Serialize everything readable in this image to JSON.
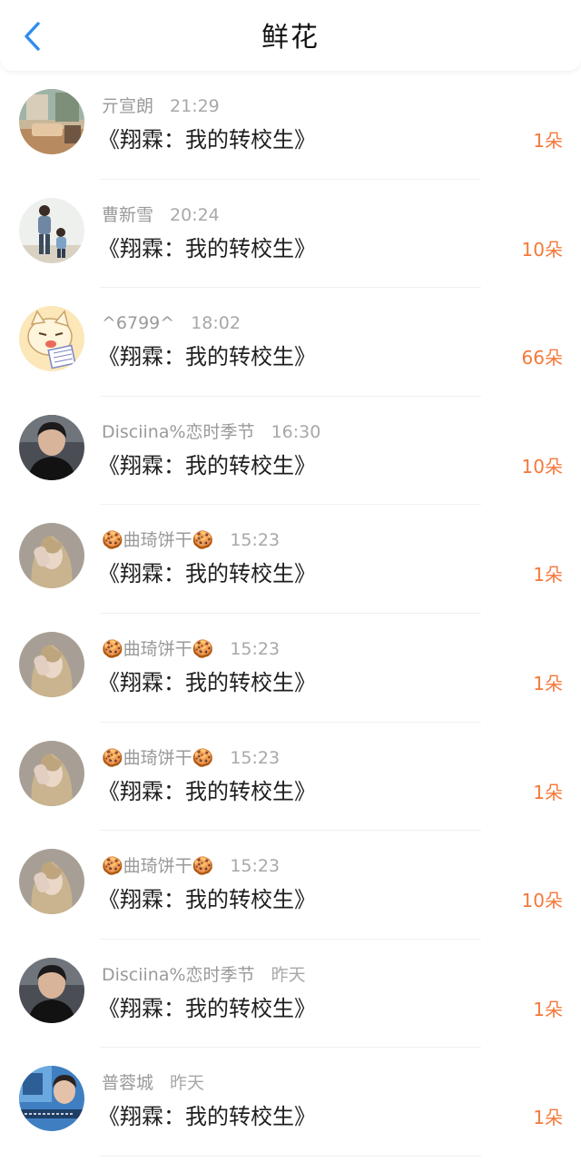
{
  "nav": {
    "title": "鲜花",
    "back_icon": "chevron-left-icon",
    "accent": "#2f8cf0"
  },
  "colors": {
    "count": "#f5783a"
  },
  "items": [
    {
      "name": "亓宣朗",
      "time": "21:29",
      "book": "《翔霖：我的转校生》",
      "count": "1朵",
      "avatar": "room-photo"
    },
    {
      "name": "曹新雪",
      "time": "20:24",
      "book": "《翔霖：我的转校生》",
      "count": "10朵",
      "avatar": "father-child-photo"
    },
    {
      "name": "^6799^",
      "time": "18:02",
      "book": "《翔霖：我的转校生》",
      "count": "66朵",
      "avatar": "cartoon-cat"
    },
    {
      "name": "Disciina%恋时季节",
      "time": "16:30",
      "book": "《翔霖：我的转校生》",
      "count": "10朵",
      "avatar": "boy-photo"
    },
    {
      "name": "🍪曲琦饼干🍪",
      "time": "15:23",
      "book": "《翔霖：我的转校生》",
      "count": "1朵",
      "avatar": "girl-photo"
    },
    {
      "name": "🍪曲琦饼干🍪",
      "time": "15:23",
      "book": "《翔霖：我的转校生》",
      "count": "1朵",
      "avatar": "girl-photo"
    },
    {
      "name": "🍪曲琦饼干🍪",
      "time": "15:23",
      "book": "《翔霖：我的转校生》",
      "count": "1朵",
      "avatar": "girl-photo"
    },
    {
      "name": "🍪曲琦饼干🍪",
      "time": "15:23",
      "book": "《翔霖：我的转校生》",
      "count": "10朵",
      "avatar": "girl-photo"
    },
    {
      "name": "Disciina%恋时季节",
      "time": "昨天",
      "book": "《翔霖：我的转校生》",
      "count": "1朵",
      "avatar": "boy-photo"
    },
    {
      "name": "普蓉城",
      "time": "昨天",
      "book": "《翔霖：我的转校生》",
      "count": "1朵",
      "avatar": "blue-scene-photo"
    }
  ]
}
